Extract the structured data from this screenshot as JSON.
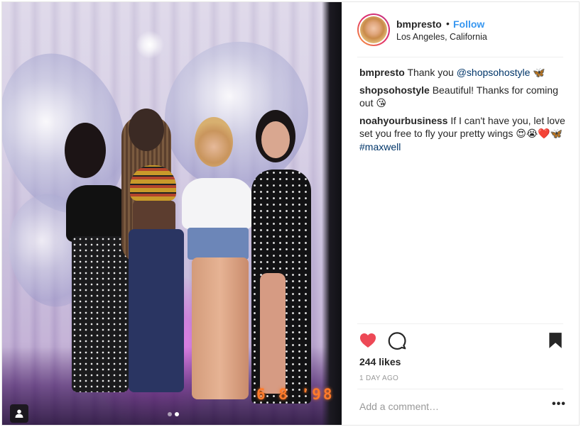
{
  "post": {
    "image": {
      "datestamp": "6 8 '98",
      "carousel_pages": 2,
      "carousel_current": 2
    },
    "header": {
      "username": "bmpresto",
      "separator": "•",
      "follow_label": "Follow",
      "location": "Los Angeles, California"
    },
    "comments": [
      {
        "user": "bmpresto",
        "text_before": "Thank you ",
        "mention": "@shopsohostyle",
        "text_after": " ",
        "emoji": "🦋"
      },
      {
        "user": "shopsohostyle",
        "text": "Beautiful! Thanks for coming out ",
        "emoji": "😘"
      },
      {
        "user": "noahyourbusiness",
        "text": "If I can't have you, let love set you free to fly your pretty wings ",
        "emoji": "😍😭❤️🦋",
        "hashtag": "#maxwell"
      }
    ],
    "actions": {
      "like_icon": "heart-icon",
      "comment_icon": "comment-icon",
      "save_icon": "bookmark-icon",
      "liked": true,
      "like_color": "#ed4956"
    },
    "likes": "244 likes",
    "time_ago": "1 DAY AGO",
    "add_comment_placeholder": "Add a comment…",
    "more_label": "•••"
  },
  "colors": {
    "follow": "#3897f0",
    "text": "#262626",
    "muted": "#999999",
    "link": "#003569",
    "datestamp": "#ff7a2a"
  }
}
